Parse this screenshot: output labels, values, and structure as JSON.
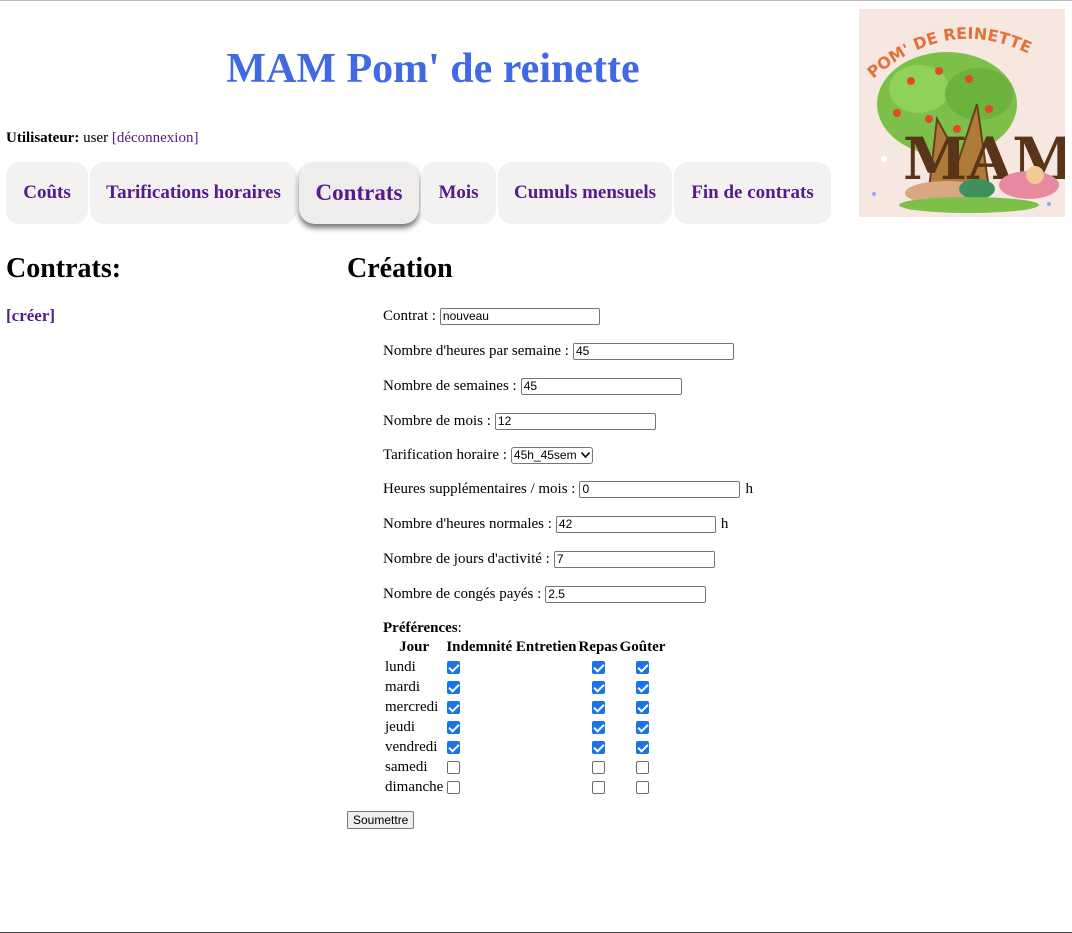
{
  "header": {
    "site_title": "MAM Pom' de reinette",
    "logo_text": "POM' DE REINETTE",
    "logo_letters": "MAM"
  },
  "user": {
    "label": "Utilisateur:",
    "name": "user",
    "logout": "[déconnexion]"
  },
  "nav": {
    "tabs": [
      {
        "label": "Coûts"
      },
      {
        "label": "Tarifications horaires"
      },
      {
        "label": "Contrats",
        "active": true
      },
      {
        "label": "Mois"
      },
      {
        "label": "Cumuls mensuels"
      },
      {
        "label": "Fin de contrats"
      }
    ]
  },
  "left": {
    "heading": "Contrats:",
    "create_link": "[créer]"
  },
  "form": {
    "heading": "Création",
    "fields": [
      {
        "label": "Contrat :",
        "value": "nouveau"
      },
      {
        "label": "Nombre d'heures par semaine :",
        "value": "45"
      },
      {
        "label": "Nombre de semaines :",
        "value": "45"
      },
      {
        "label": "Nombre de mois :",
        "value": "12"
      },
      {
        "label": "Tarification horaire :",
        "value": "45h_45sem"
      },
      {
        "label": "Heures supplémentaires / mois :",
        "value": "0",
        "unit": "h"
      },
      {
        "label": "Nombre d'heures normales :",
        "value": "42",
        "unit": "h"
      },
      {
        "label": "Nombre de jours d'activité :",
        "value": "7"
      },
      {
        "label": "Nombre de congés payés :",
        "value": "2.5"
      }
    ],
    "preferences_label": "Préférences",
    "pref_headers": [
      "Jour",
      "Indemnité Entretien",
      "Repas",
      "Goûter"
    ],
    "days": [
      {
        "name": "lundi",
        "indemnite": true,
        "repas": true,
        "gouter": true
      },
      {
        "name": "mardi",
        "indemnite": true,
        "repas": true,
        "gouter": true
      },
      {
        "name": "mercredi",
        "indemnite": true,
        "repas": true,
        "gouter": true
      },
      {
        "name": "jeudi",
        "indemnite": true,
        "repas": true,
        "gouter": true
      },
      {
        "name": "vendredi",
        "indemnite": true,
        "repas": true,
        "gouter": true
      },
      {
        "name": "samedi",
        "indemnite": false,
        "repas": false,
        "gouter": false
      },
      {
        "name": "dimanche",
        "indemnite": false,
        "repas": false,
        "gouter": false
      }
    ],
    "submit_label": "Soumettre"
  },
  "colors": {
    "title_blue": "#4169e1",
    "link_purple": "#551a8b",
    "tab_bg": "#f4f1f1",
    "checkbox_blue": "#1a73e8"
  }
}
